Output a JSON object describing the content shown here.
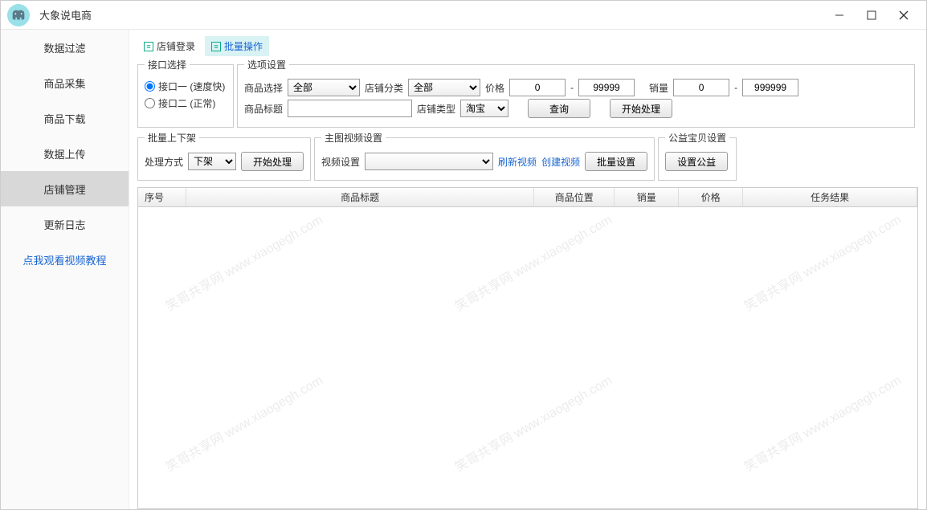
{
  "title": "大象说电商",
  "sidebar": {
    "items": [
      {
        "label": "数据过滤"
      },
      {
        "label": "商品采集"
      },
      {
        "label": "商品下载"
      },
      {
        "label": "数据上传"
      },
      {
        "label": "店铺管理"
      },
      {
        "label": "更新日志"
      }
    ],
    "link": "点我观看视频教程"
  },
  "tabs": {
    "t0": "店铺登录",
    "t1": "批量操作"
  },
  "fs": {
    "interface": "接口选择",
    "options": "选项设置",
    "batch_shelf": "批量上下架",
    "main_video": "主图视频设置",
    "public_welfare": "公益宝贝设置"
  },
  "radios": {
    "r1": "接口一 (速度快)",
    "r2": "接口二 (正常)"
  },
  "labels": {
    "product_select": "商品选择",
    "shop_category": "店铺分类",
    "price": "价格",
    "sales": "销量",
    "product_title": "商品标题",
    "shop_type": "店铺类型",
    "process_mode": "处理方式",
    "video_setting": "视频设置",
    "dash": "-"
  },
  "selects": {
    "product_select": "全部",
    "shop_category": "全部",
    "shop_type": "淘宝",
    "process_mode": "下架",
    "video_setting": ""
  },
  "inputs": {
    "price_min": "0",
    "price_max": "99999",
    "sales_min": "0",
    "sales_max": "999999",
    "product_title": ""
  },
  "buttons": {
    "query": "查询",
    "start_process": "开始处理",
    "start_process2": "开始处理",
    "batch_setting": "批量设置",
    "set_welfare": "设置公益"
  },
  "links": {
    "refresh_video": "刷新视频",
    "create_video": "创建视频"
  },
  "table": {
    "headers": [
      "序号",
      "商品标题",
      "商品位置",
      "销量",
      "价格",
      "任务结果"
    ]
  },
  "watermark": "笑哥共享网 www.xiaogegh.com"
}
